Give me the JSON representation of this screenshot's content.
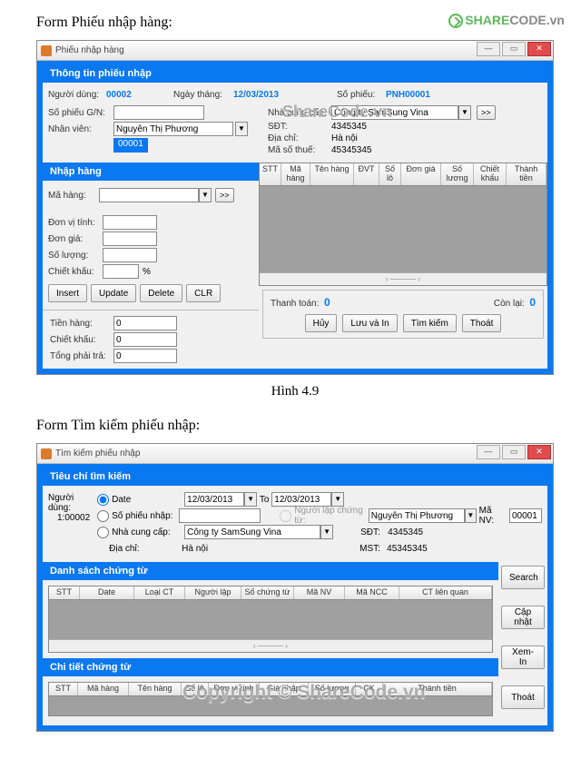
{
  "logo_text_green": "SHARE",
  "logo_text_gray": "CODE.vn",
  "watermark1": "ShareCode.vn",
  "watermark2": "Copyright © ShareCode.vn",
  "doc": {
    "heading1": "Form Phiếu nhập hàng:",
    "caption1": "Hình 4.9",
    "heading2": "Form Tìm kiếm phiếu nhập:"
  },
  "form1": {
    "win_title": "Phiếu nhập hàng",
    "header": "Thông tin phiếu nhập",
    "user_label": "Người dùng:",
    "user_value": "00002",
    "date_label": "Ngày tháng:",
    "date_value": "12/03/2013",
    "so_phieu_label": "Số phiếu:",
    "so_phieu_value": "PNH00001",
    "so_phieu_gn_label": "Số phiếu G/N:",
    "nhanvien_label": "Nhân viên:",
    "nhanvien_value": "Nguyễn Thị Phương",
    "nhanvien_code": "00001",
    "ncc_label": "Nhà cung cấp:",
    "ncc_value": "Công ty SamSung Vina",
    "sdt_label": "SĐT:",
    "sdt_value": "4345345",
    "diachi_label": "Địa chỉ:",
    "diachi_value": "Hà nội",
    "mst_label": "Mã số thuế:",
    "mst_value": "45345345",
    "more_btn": ">>",
    "nhap_hang_header": "Nhập hàng",
    "mahang_label": "Mã hàng:",
    "mahang_more": ">>",
    "dvt_label": "Đơn vị tính:",
    "dongia_label": "Đơn giá:",
    "soluong_label": "Số lượng:",
    "chietkhau_label": "Chiết khấu:",
    "percent": "%",
    "btn_insert": "Insert",
    "btn_update": "Update",
    "btn_delete": "Delete",
    "btn_clr": "CLR",
    "tienhang_label": "Tiền hàng:",
    "tienhang_value": "0",
    "ck_label": "Chiết khấu:",
    "ck_value": "0",
    "tongtra_label": "Tổng phải trả:",
    "tongtra_value": "0",
    "grid_headers": [
      "STT",
      "Mã hàng",
      "Tên hàng",
      "ĐVT",
      "Số lô",
      "Đơn giá",
      "Số lương",
      "Chiết khấu",
      "Thành tiền"
    ],
    "thanhtoan_label": "Thanh toán:",
    "thanhtoan_value": "0",
    "conlai_label": "Còn lại:",
    "conlai_value": "0",
    "btn_huy": "Hủy",
    "btn_luuin": "Lưu và In",
    "btn_timkiem": "Tìm kiếm",
    "btn_thoat": "Thoát"
  },
  "form2": {
    "win_title": "Tìm kiếm phiếu nhập",
    "header": "Tiêu chí tìm kiếm",
    "user_label": "Người dùng:",
    "user_value": "1:00002",
    "opt_date": "Date",
    "date_from": "12/03/2013",
    "to_label": "To",
    "date_to": "12/03/2013",
    "opt_sophieu": "Số  phiếu nhập:",
    "opt_nguoilap": "Người lập chứng từ:",
    "nguoilap_value": "Nguyễn Thị Phương",
    "manv_label": "Mã NV:",
    "manv_value": "00001",
    "opt_ncc": "Nhà cung cấp:",
    "ncc_value": "Công ty SamSung Vina",
    "sdt_label": "SĐT:",
    "sdt_value": "4345345",
    "diachi_label": "Địa chỉ:",
    "diachi_value": "Hà nội",
    "mst_label": "MST:",
    "mst_value": "45345345",
    "list_header": "Danh sách chứng từ",
    "grid1_headers": [
      "STT",
      "Date",
      "Loại CT",
      "Người lập",
      "Số chứng từ",
      "Mã NV",
      "Mã NCC",
      "CT liên quan"
    ],
    "detail_header": "Chi tiết chứng từ",
    "grid2_headers": [
      "STT",
      "Mã hàng",
      "Tên hàng",
      "Số lô",
      "Đơn vị tính",
      "Giá nhập",
      "Số lượng",
      "CK",
      "Thành tiền"
    ],
    "btn_search": "Search",
    "btn_capnhat": "Cập nhật",
    "btn_xemin": "Xem-In",
    "btn_thoat": "Thoát"
  }
}
